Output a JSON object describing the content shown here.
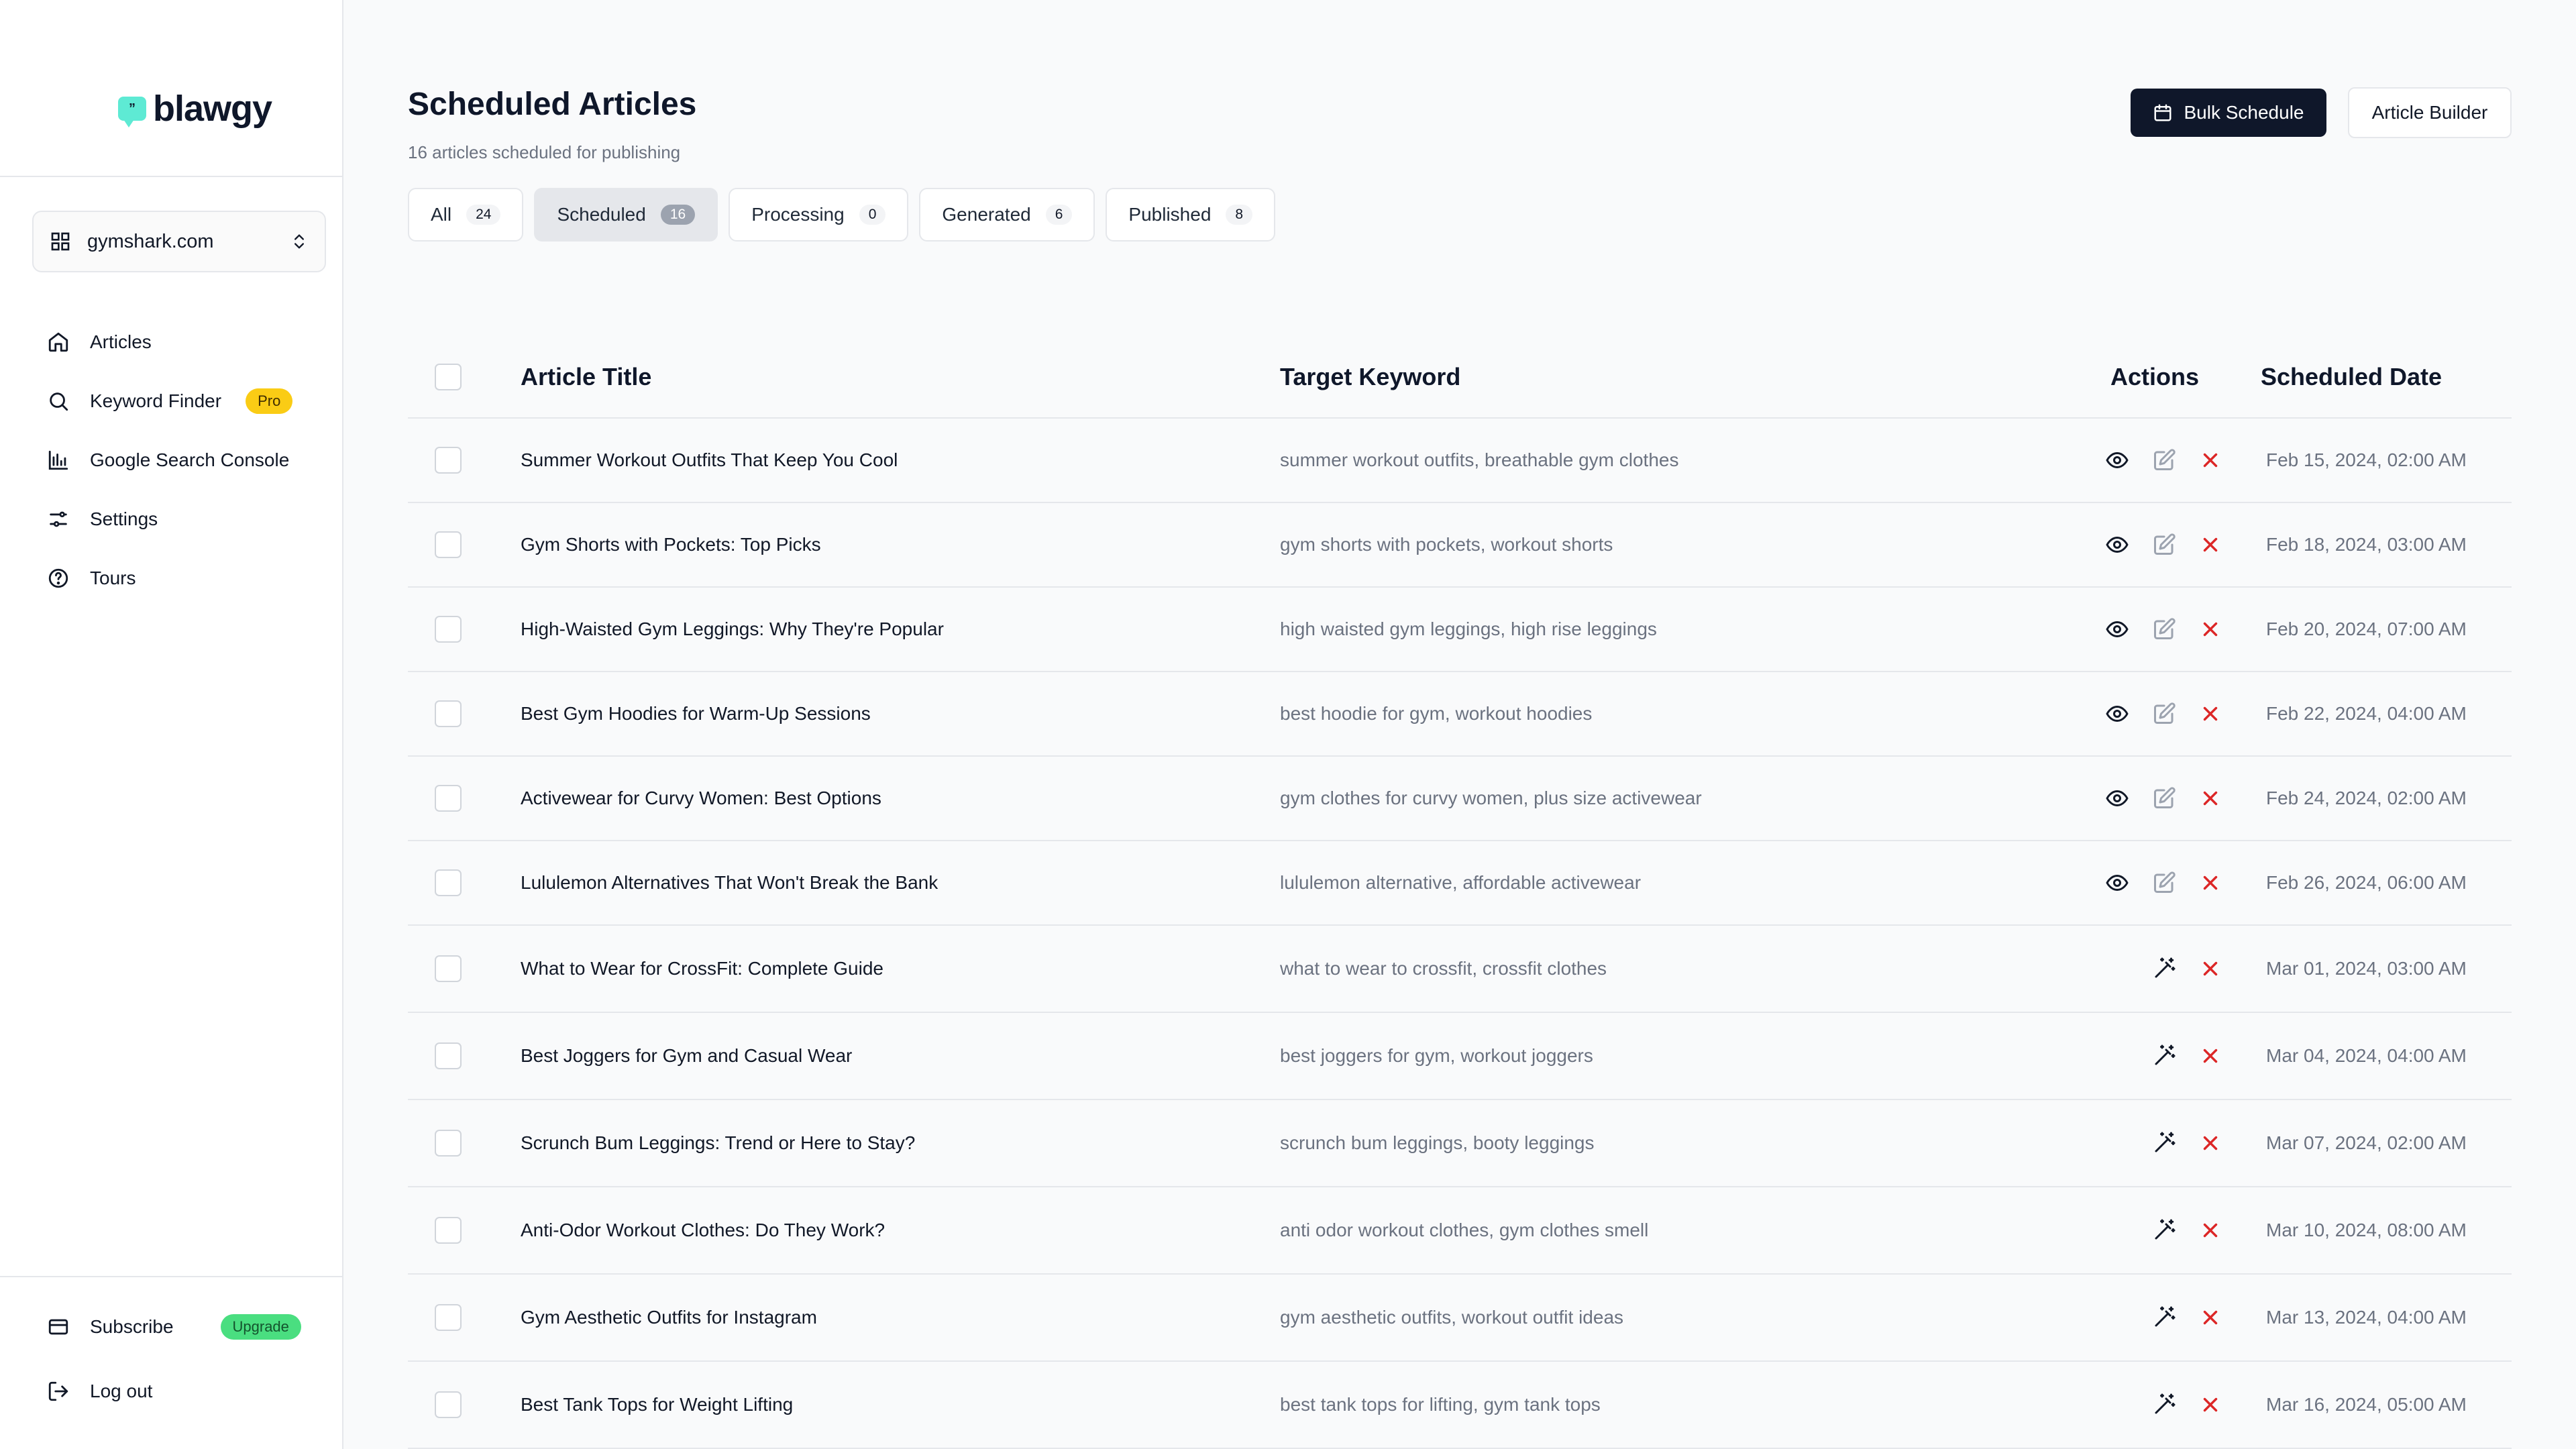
{
  "brand": {
    "name": "blawgy",
    "mark": "”"
  },
  "site_selector": {
    "value": "gymshark.com"
  },
  "nav": [
    {
      "label": "Articles",
      "icon": "home-icon"
    },
    {
      "label": "Keyword Finder",
      "icon": "search-icon",
      "badge": "Pro"
    },
    {
      "label": "Google Search Console",
      "icon": "bar-chart-icon"
    },
    {
      "label": "Settings",
      "icon": "sliders-icon"
    },
    {
      "label": "Tours",
      "icon": "help-circle-icon"
    }
  ],
  "bottom_nav": [
    {
      "label": "Subscribe",
      "icon": "credit-card-icon",
      "badge": "Upgrade"
    },
    {
      "label": "Log out",
      "icon": "logout-icon"
    }
  ],
  "header": {
    "title": "Scheduled Articles",
    "subtitle": "16 articles scheduled for publishing",
    "bulk_schedule": "Bulk Schedule",
    "article_builder": "Article Builder"
  },
  "tabs": [
    {
      "label": "All",
      "count": "24"
    },
    {
      "label": "Scheduled",
      "count": "16",
      "active": true
    },
    {
      "label": "Processing",
      "count": "0"
    },
    {
      "label": "Generated",
      "count": "6"
    },
    {
      "label": "Published",
      "count": "8"
    }
  ],
  "table": {
    "headers": {
      "title": "Article Title",
      "keyword": "Target Keyword",
      "actions": "Actions",
      "date": "Scheduled Date"
    },
    "rows": [
      {
        "title": "Summer Workout Outfits That Keep You Cool",
        "keyword": "summer workout outfits, breathable gym clothes",
        "date": "Feb 15, 2024, 02:00 AM",
        "status": "generated"
      },
      {
        "title": "Gym Shorts with Pockets: Top Picks",
        "keyword": "gym shorts with pockets, workout shorts",
        "date": "Feb 18, 2024, 03:00 AM",
        "status": "generated"
      },
      {
        "title": "High-Waisted Gym Leggings: Why They're Popular",
        "keyword": "high waisted gym leggings, high rise leggings",
        "date": "Feb 20, 2024, 07:00 AM",
        "status": "generated"
      },
      {
        "title": "Best Gym Hoodies for Warm-Up Sessions",
        "keyword": "best hoodie for gym, workout hoodies",
        "date": "Feb 22, 2024, 04:00 AM",
        "status": "generated"
      },
      {
        "title": "Activewear for Curvy Women: Best Options",
        "keyword": "gym clothes for curvy women, plus size activewear",
        "date": "Feb 24, 2024, 02:00 AM",
        "status": "generated"
      },
      {
        "title": "Lululemon Alternatives That Won't Break the Bank",
        "keyword": "lululemon alternative, affordable activewear",
        "date": "Feb 26, 2024, 06:00 AM",
        "status": "generated"
      },
      {
        "title": "What to Wear for CrossFit: Complete Guide",
        "keyword": "what to wear to crossfit, crossfit clothes",
        "date": "Mar 01, 2024, 03:00 AM",
        "status": "pending"
      },
      {
        "title": "Best Joggers for Gym and Casual Wear",
        "keyword": "best joggers for gym, workout joggers",
        "date": "Mar 04, 2024, 04:00 AM",
        "status": "pending"
      },
      {
        "title": "Scrunch Bum Leggings: Trend or Here to Stay?",
        "keyword": "scrunch bum leggings, booty leggings",
        "date": "Mar 07, 2024, 02:00 AM",
        "status": "pending"
      },
      {
        "title": "Anti-Odor Workout Clothes: Do They Work?",
        "keyword": "anti odor workout clothes, gym clothes smell",
        "date": "Mar 10, 2024, 08:00 AM",
        "status": "pending"
      },
      {
        "title": "Gym Aesthetic Outfits for Instagram",
        "keyword": "gym aesthetic outfits, workout outfit ideas",
        "date": "Mar 13, 2024, 04:00 AM",
        "status": "pending"
      },
      {
        "title": "Best Tank Tops for Weight Lifting",
        "keyword": "best tank tops for lifting, gym tank tops",
        "date": "Mar 16, 2024, 05:00 AM",
        "status": "pending"
      }
    ]
  },
  "colors": {
    "primary": "#0f172a",
    "delete": "#dc2626",
    "pro_badge": "#facc15",
    "upgrade_badge": "#4ade80",
    "logo": "#5eead4"
  }
}
